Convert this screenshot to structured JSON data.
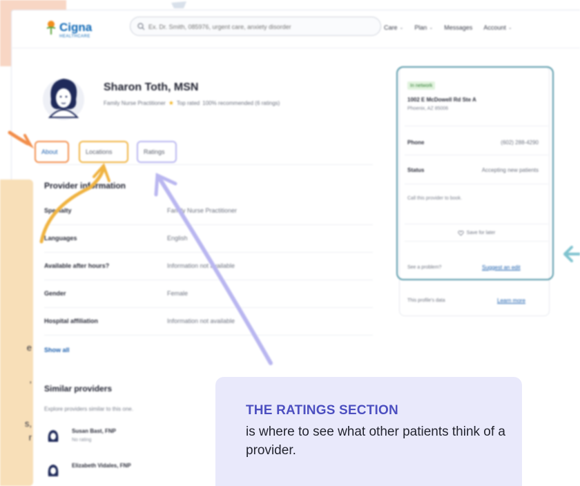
{
  "header": {
    "logo_text": "Cigna",
    "logo_sub": "HEALTHCARE",
    "search_placeholder": "Ex. Dr. Smith, 085976, urgent care, anxiety disorder",
    "nav": [
      "Care",
      "Plan",
      "Messages",
      "Account"
    ]
  },
  "provider": {
    "name": "Sharon Toth, MSN",
    "specialty_line": "Family Nurse Practitioner",
    "top_rated": "Top rated",
    "recommended": "100% recommended (6 ratings)"
  },
  "tabs": [
    "About",
    "Locations",
    "Ratings"
  ],
  "info": {
    "title": "Provider information",
    "rows": [
      {
        "label": "Specialty",
        "value": "Family Nurse Practitioner"
      },
      {
        "label": "Languages",
        "value": "English"
      },
      {
        "label": "Available after hours?",
        "value": "Information not available"
      },
      {
        "label": "Gender",
        "value": "Female"
      },
      {
        "label": "Hospital affiliation",
        "value": "Information not available"
      }
    ],
    "show_all": "Show all"
  },
  "similar": {
    "title": "Similar providers",
    "subtitle": "Explore providers similar to this one.",
    "items": [
      {
        "name": "Susan Bast, FNP",
        "rating": "No rating"
      },
      {
        "name": "Elizabeth Vidales, FNP",
        "rating": ""
      }
    ]
  },
  "card": {
    "badge": "In network",
    "address1": "1002 E McDowell Rd Ste A",
    "address2": "Phoenix, AZ 85006",
    "phone_label": "Phone",
    "phone_value": "(602) 288-4290",
    "status_label": "Status",
    "status_value": "Accepting new patients",
    "note": "Call this provider to book.",
    "save_label": "Save for later",
    "problem_text": "See a problem?",
    "suggest_link": "Suggest an edit",
    "data_text": "This profile's data",
    "learn_link": "Learn more"
  },
  "left_panel": {
    "fragments": [
      "e",
      ",",
      "s,",
      "r"
    ]
  },
  "callout": {
    "title": "THE RATINGS SECTION",
    "body": "is where to see what other patients think of a provider."
  },
  "colors": {
    "accent_orange": "#f28e4b",
    "accent_yellow": "#f0b340",
    "accent_lavender": "#b9b6f0",
    "card_border": "#5a9bab",
    "callout_bg": "#e9e9fb",
    "callout_title": "#4c4fc0",
    "brand_blue": "#0b66b5"
  }
}
